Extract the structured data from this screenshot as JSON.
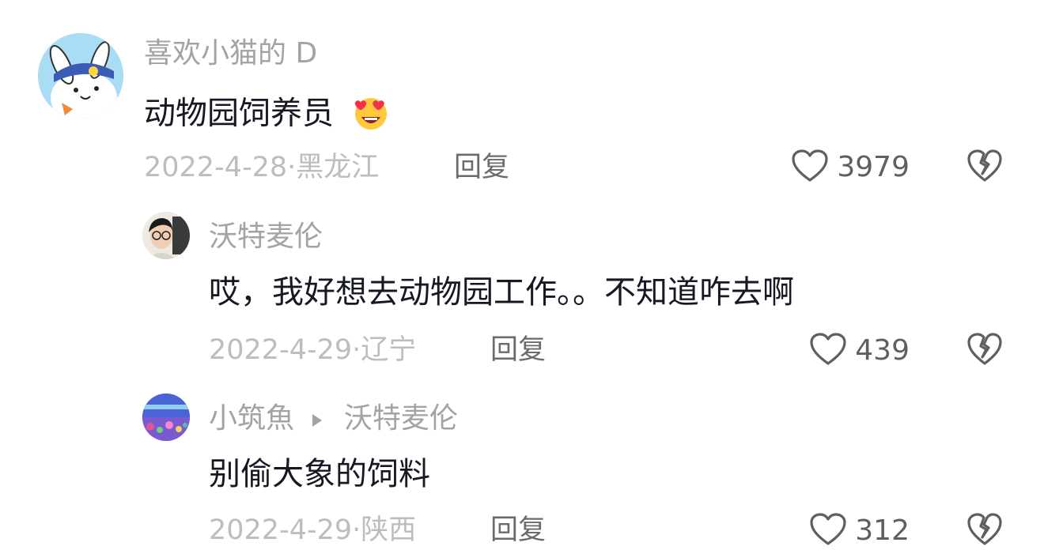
{
  "comments": [
    {
      "username": "喜欢小猫的 D",
      "text": "动物园饲养员",
      "emoji": "😍",
      "date": "2022-4-28",
      "region": "黑龙江",
      "reply_label": "回复",
      "likes": "3979"
    },
    {
      "username": "沃特麦伦",
      "text": "哎，我好想去动物园工作。。不知道咋去啊",
      "date": "2022-4-29",
      "region": "辽宁",
      "reply_label": "回复",
      "likes": "439"
    },
    {
      "username": "小筑魚",
      "reply_to": "沃特麦伦",
      "text": "别偷大象的饲料",
      "date": "2022-4-29",
      "region": "陕西",
      "reply_label": "回复",
      "likes": "312"
    }
  ],
  "icons": {
    "like": "heart-outline-icon",
    "dislike": "broken-heart-icon",
    "reply_arrow": "triangle-right-icon"
  },
  "colors": {
    "username": "#a3a3a3",
    "text": "#161823",
    "meta": "#bdbdbd",
    "reply": "#6b6b6b",
    "icon": "#5f5f5f"
  }
}
